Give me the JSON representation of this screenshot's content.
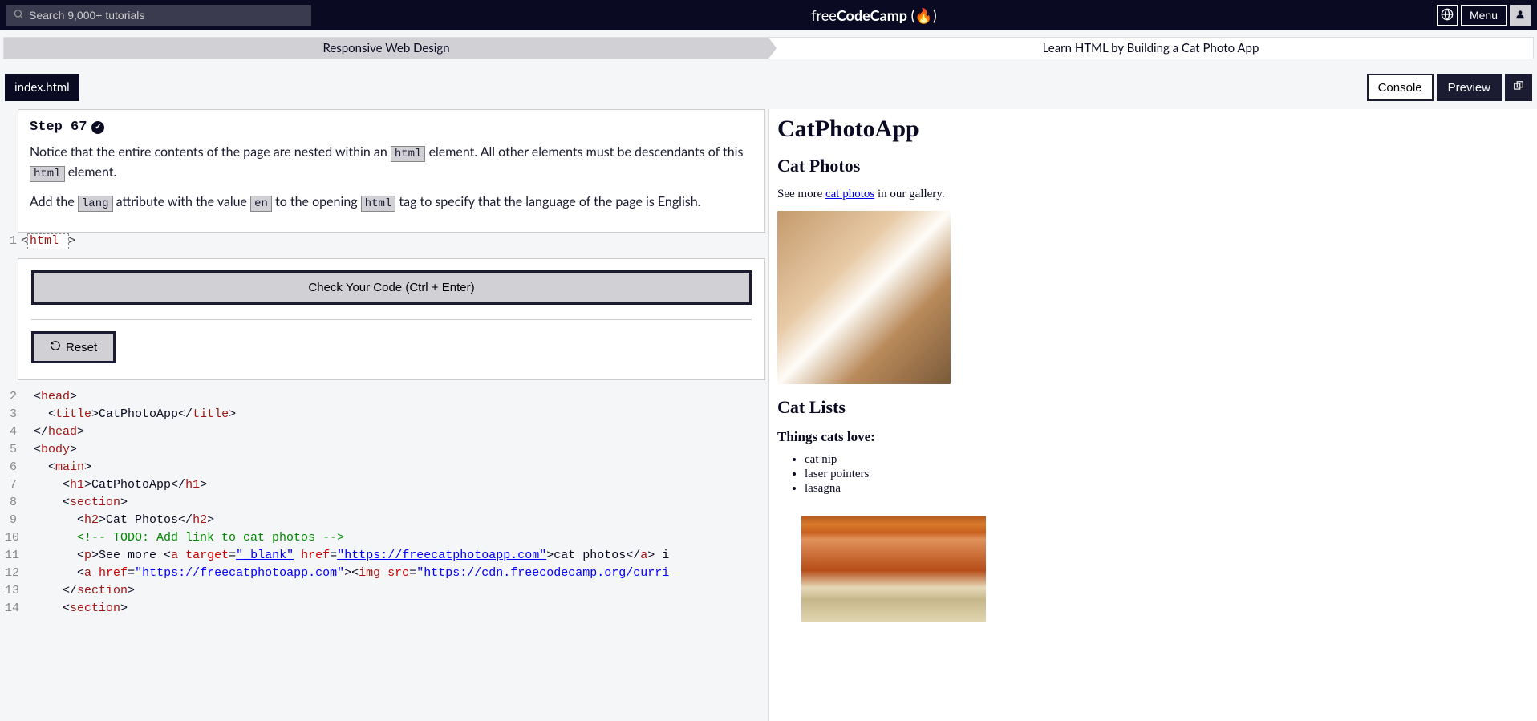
{
  "header": {
    "search_placeholder": "Search 9,000+ tutorials",
    "brand_thin": "free",
    "brand_bold": "CodeCamp",
    "menu_label": "Menu"
  },
  "breadcrumb": {
    "course": "Responsive Web Design",
    "lesson": "Learn HTML by Building a Cat Photo App"
  },
  "tabs": {
    "file": "index.html"
  },
  "toolbar": {
    "console": "Console",
    "preview": "Preview"
  },
  "step": {
    "title": "Step 67",
    "p1_a": "Notice that the entire contents of the page are nested within an ",
    "p1_code": "html",
    "p1_b": " element. All other elements must be descendants of this ",
    "p1_code2": "html",
    "p1_c": " element.",
    "p2_a": "Add the ",
    "p2_code_lang": "lang",
    "p2_b": " attribute with the value ",
    "p2_code_en": "en",
    "p2_c": " to the opening ",
    "p2_code_html": "html",
    "p2_d": " tag to specify that the language of the page is English."
  },
  "editor": {
    "editable_value": "html",
    "check_label": "Check Your Code (Ctrl + Enter)",
    "reset_label": "Reset",
    "lines": [
      {
        "n": "1"
      },
      {
        "n": "2",
        "html": "  &lt;<span class='tok-tag'>head</span>&gt;"
      },
      {
        "n": "3",
        "html": "    &lt;<span class='tok-tag'>title</span>&gt;CatPhotoApp&lt;/<span class='tok-tag'>title</span>&gt;"
      },
      {
        "n": "4",
        "html": "  &lt;/<span class='tok-tag'>head</span>&gt;"
      },
      {
        "n": "5",
        "html": "  &lt;<span class='tok-tag'>body</span>&gt;"
      },
      {
        "n": "6",
        "html": "    &lt;<span class='tok-tag'>main</span>&gt;"
      },
      {
        "n": "7",
        "html": "      &lt;<span class='tok-tag'>h1</span>&gt;CatPhotoApp&lt;/<span class='tok-tag'>h1</span>&gt;"
      },
      {
        "n": "8",
        "html": "      &lt;<span class='tok-tag'>section</span>&gt;"
      },
      {
        "n": "9",
        "html": "        &lt;<span class='tok-tag'>h2</span>&gt;Cat Photos&lt;/<span class='tok-tag'>h2</span>&gt;"
      },
      {
        "n": "10",
        "html": "        <span class='tok-comment'>&lt;!-- TODO: Add link to cat photos --&gt;</span>"
      },
      {
        "n": "11",
        "html": "        &lt;<span class='tok-tag'>p</span>&gt;See more &lt;<span class='tok-tag'>a</span> <span class='tok-attr'>target</span>=<span class='tok-str'>\"_blank\"</span> <span class='tok-attr'>href</span>=<span class='tok-str'>\"https://freecatphotoapp.com\"</span>&gt;cat photos&lt;/<span class='tok-tag'>a</span>&gt; i"
      },
      {
        "n": "12",
        "html": "        &lt;<span class='tok-tag'>a</span> <span class='tok-attr'>href</span>=<span class='tok-str'>\"https://freecatphotoapp.com\"</span>&gt;&lt;<span class='tok-tag'>img</span> <span class='tok-attr'>src</span>=<span class='tok-str'>\"https://cdn.freecodecamp.org/curri</span>"
      },
      {
        "n": "13",
        "html": "      &lt;/<span class='tok-tag'>section</span>&gt;"
      },
      {
        "n": "14",
        "html": "      &lt;<span class='tok-tag'>section</span>&gt;"
      }
    ]
  },
  "preview": {
    "h1": "CatPhotoApp",
    "h2_photos": "Cat Photos",
    "see_more_a": "See more ",
    "link": "cat photos",
    "see_more_b": " in our gallery.",
    "h2_lists": "Cat Lists",
    "h3_love": "Things cats love:",
    "love_items": [
      "cat nip",
      "laser pointers",
      "lasagna"
    ]
  }
}
